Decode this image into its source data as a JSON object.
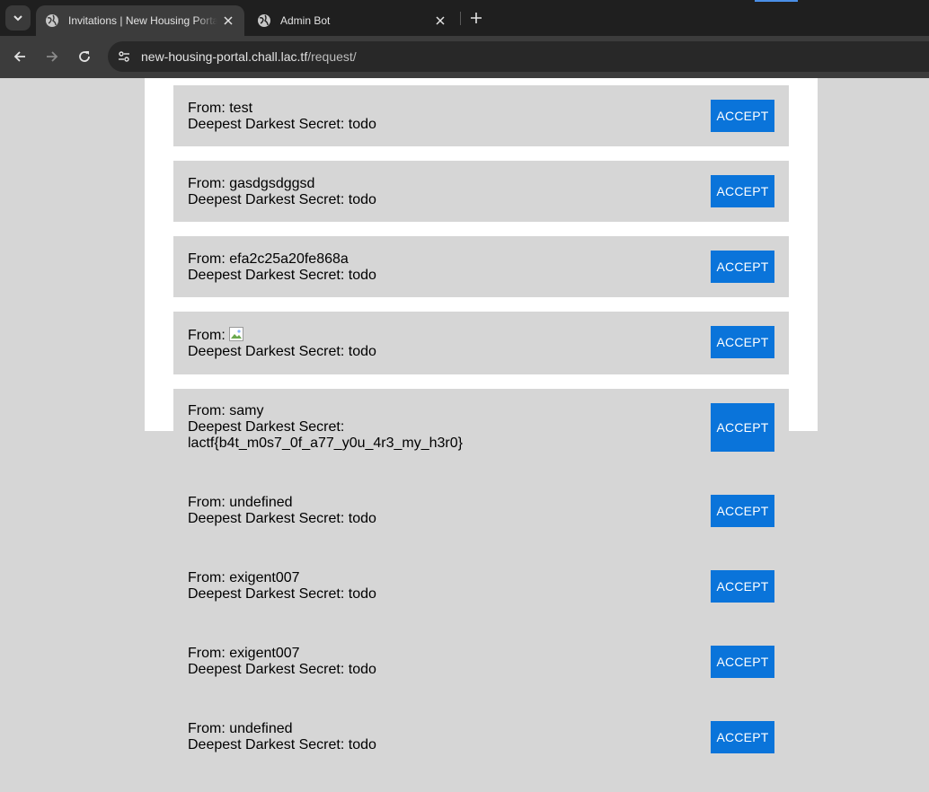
{
  "browser": {
    "tabs": [
      {
        "title": "Invitations | New Housing Portal",
        "active": true
      },
      {
        "title": "Admin Bot",
        "active": false
      }
    ],
    "new_tab_label": "+",
    "url_host": "new-housing-portal.chall.lac.tf",
    "url_path": "/request/"
  },
  "invitations": [
    {
      "from_label": "From: test",
      "secret_label": "Deepest Darkest Secret: todo",
      "secret_value": "",
      "button": "ACCEPT"
    },
    {
      "from_label": "From: gasdgsdggsd",
      "secret_label": "Deepest Darkest Secret: todo",
      "secret_value": "",
      "button": "ACCEPT"
    },
    {
      "from_label": "From: efa2c25a20fe868a",
      "secret_label": "Deepest Darkest Secret: todo",
      "secret_value": "",
      "button": "ACCEPT"
    },
    {
      "from_label": "From:",
      "secret_label": "Deepest Darkest Secret: todo",
      "secret_value": "",
      "button": "ACCEPT",
      "broken_image": true
    },
    {
      "from_label": "From: samy",
      "secret_label": "Deepest Darkest Secret:",
      "secret_value": "lactf{b4t_m0s7_0f_a77_y0u_4r3_my_h3r0}",
      "button": "ACCEPT"
    },
    {
      "from_label": "From: undefined",
      "secret_label": "Deepest Darkest Secret: todo",
      "secret_value": "",
      "button": "ACCEPT"
    },
    {
      "from_label": "From: exigent007",
      "secret_label": "Deepest Darkest Secret: todo",
      "secret_value": "",
      "button": "ACCEPT"
    },
    {
      "from_label": "From: exigent007",
      "secret_label": "Deepest Darkest Secret: todo",
      "secret_value": "",
      "button": "ACCEPT"
    },
    {
      "from_label": "From: undefined",
      "secret_label": "Deepest Darkest Secret: todo",
      "secret_value": "",
      "button": "ACCEPT"
    }
  ],
  "colors": {
    "accept_button": "#0a74da",
    "card_background": "#d6d6d6",
    "panel_background": "#ffffff"
  }
}
